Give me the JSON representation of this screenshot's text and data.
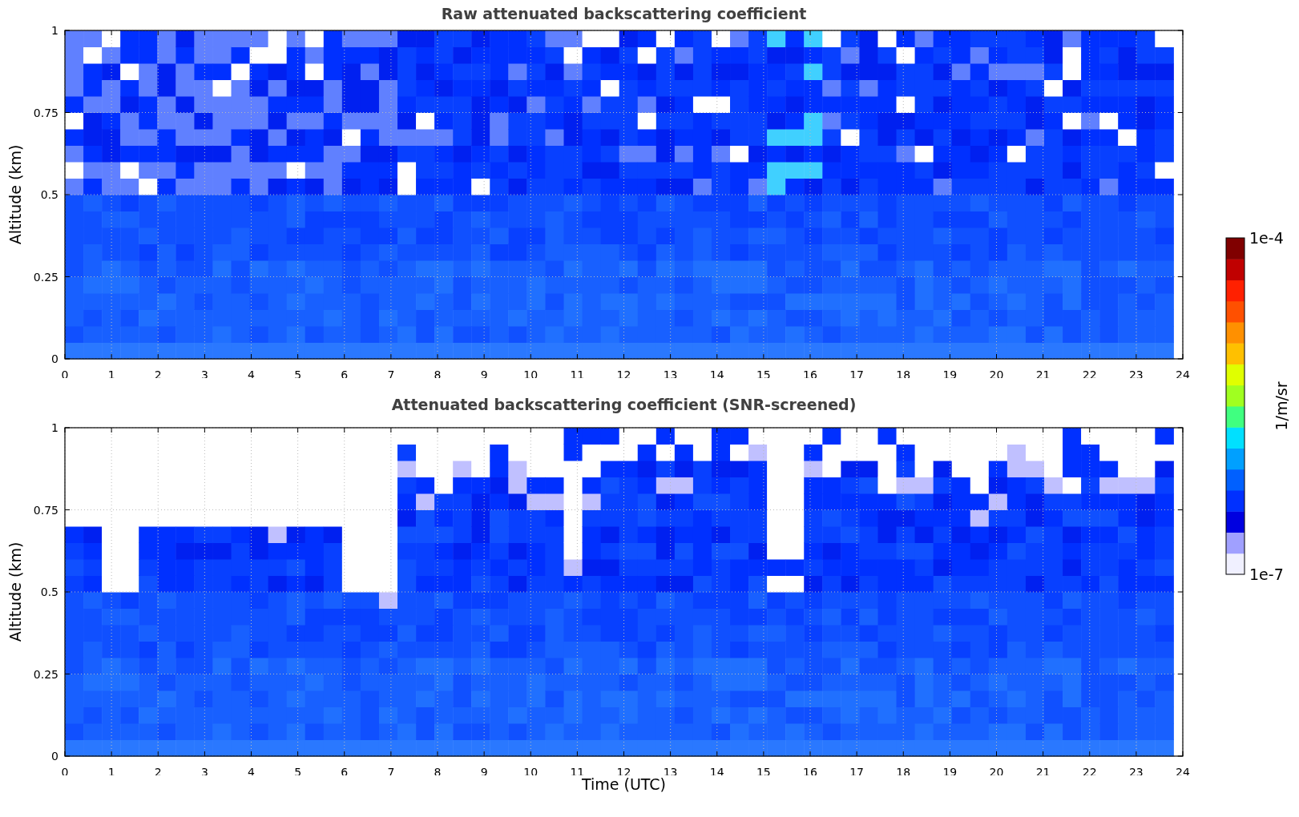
{
  "panels": [
    {
      "kind": "raw",
      "title": "Raw attenuated backscattering coefficient",
      "ylabel": "Altitude (km)",
      "yticks": [
        "1",
        "0.75",
        "0.5",
        "0.25",
        "0"
      ],
      "xticks": [
        "0",
        "1",
        "2",
        "3",
        "4",
        "5",
        "6",
        "7",
        "8",
        "9",
        "10",
        "11",
        "12",
        "13",
        "14",
        "15",
        "16",
        "17",
        "18",
        "19",
        "20",
        "21",
        "22",
        "23",
        "24"
      ]
    },
    {
      "kind": "screened",
      "title": "Attenuated backscattering coefficient (SNR-screened)",
      "ylabel": "Altitude (km)",
      "yticks": [
        "1",
        "0.75",
        "0.5",
        "0.25",
        "0"
      ],
      "xticks": [
        "0",
        "1",
        "2",
        "3",
        "4",
        "5",
        "6",
        "7",
        "8",
        "9",
        "10",
        "11",
        "12",
        "13",
        "14",
        "15",
        "16",
        "17",
        "18",
        "19",
        "20",
        "21",
        "22",
        "23",
        "24"
      ]
    }
  ],
  "xlabel": "Time (UTC)",
  "colorbar": {
    "max_label": "1e-4",
    "min_label": "1e-7",
    "unit": "1/m/sr"
  }
}
